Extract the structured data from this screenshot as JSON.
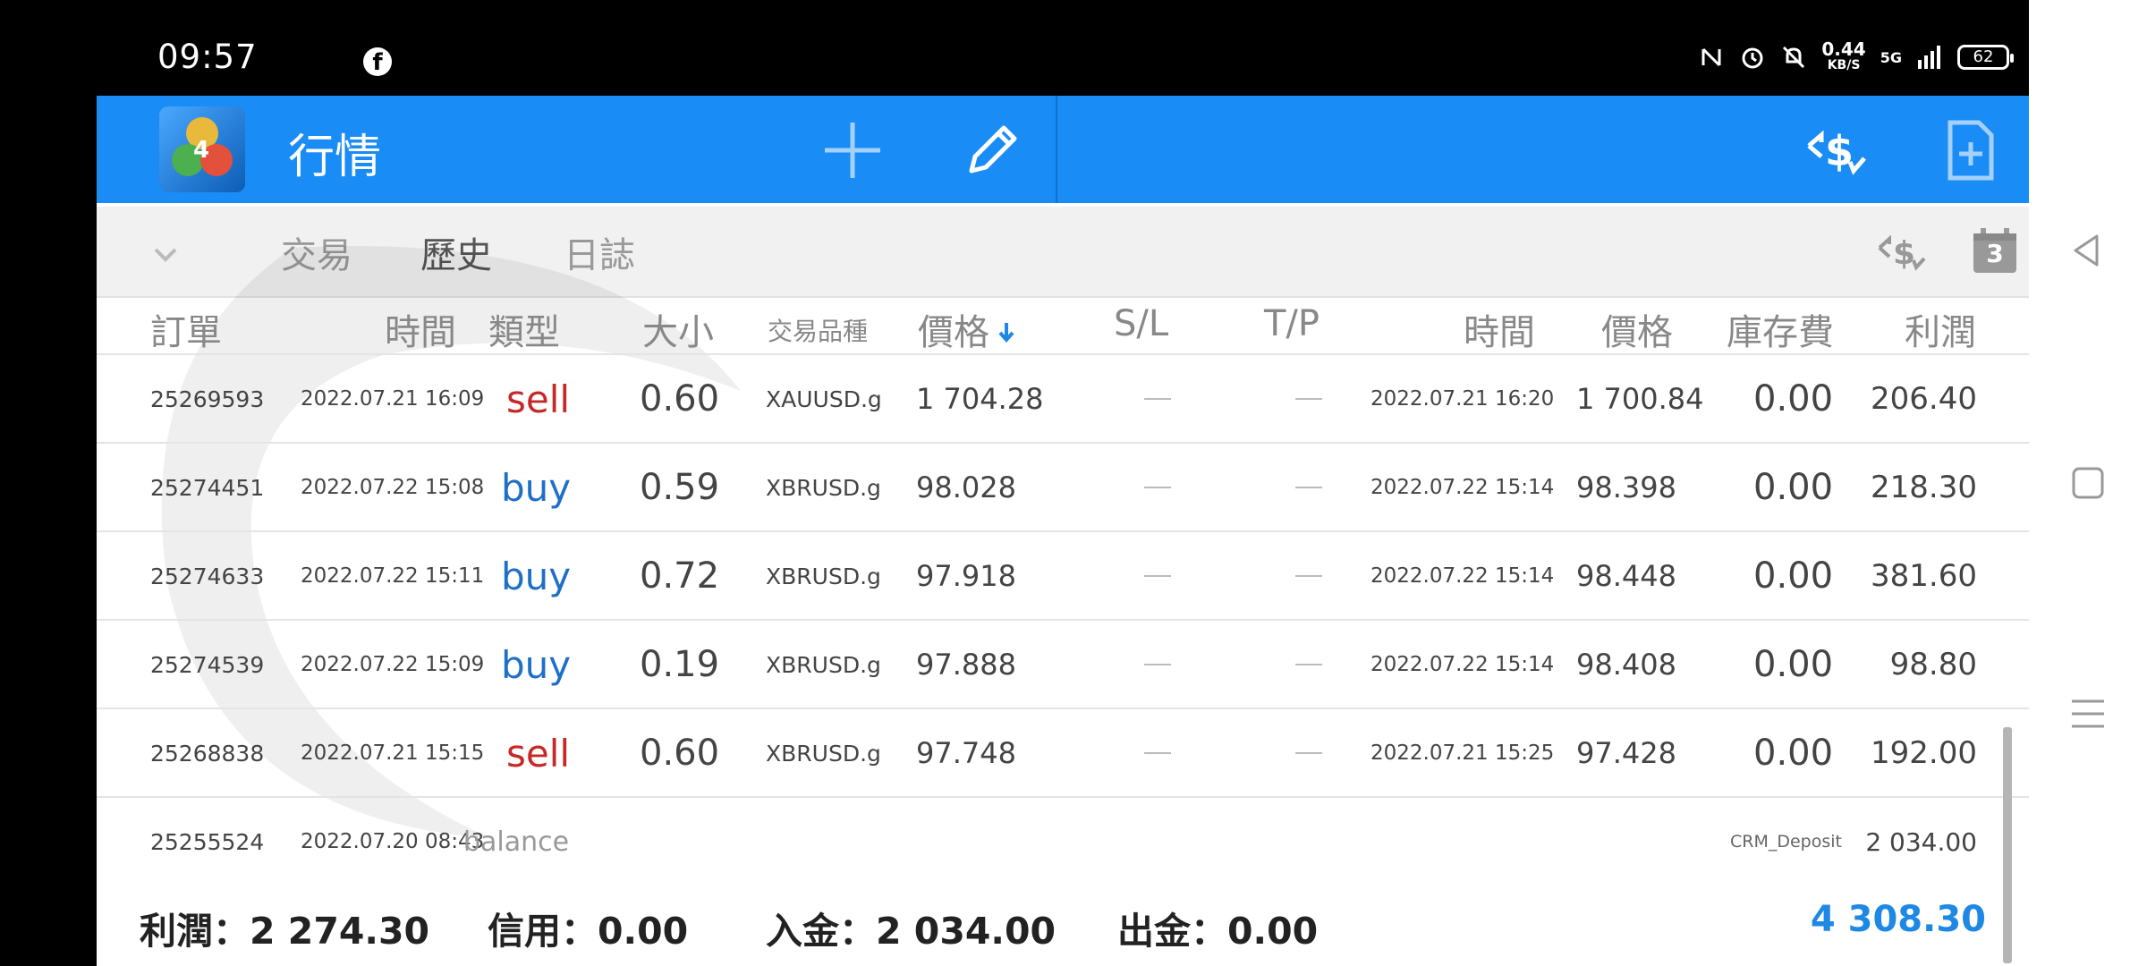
{
  "status_bar": {
    "time": "09:57",
    "speed_value": "0.44",
    "speed_unit": "KB/S",
    "network": "5G",
    "battery": "62",
    "icons": [
      "facebook-icon",
      "nfc-icon",
      "alarm-icon",
      "mute-icon",
      "signal-icon",
      "battery-icon"
    ]
  },
  "app_bar": {
    "title": "行情",
    "icons": [
      "add-icon",
      "edit-icon",
      "currency-exchange-icon",
      "new-document-icon"
    ],
    "color": "#1a8cf5"
  },
  "tabs": {
    "items": [
      "交易",
      "歷史",
      "日誌"
    ],
    "active": "歷史",
    "calendar_day": "3"
  },
  "table": {
    "headers": {
      "order": "訂單",
      "time": "時間",
      "type": "類型",
      "size": "大小",
      "symbol": "交易品種",
      "price": "價格",
      "sl": "S/L",
      "tp": "T/P",
      "close_time": "時間",
      "close_price": "價格",
      "swap": "庫存費",
      "profit": "利潤"
    },
    "rows": [
      {
        "order": "25269593",
        "time": "2022.07.21 16:09",
        "type": "sell",
        "size": "0.60",
        "symbol": "XAUUSD.g",
        "price": "1 704.28",
        "close_time": "2022.07.21 16:20",
        "close_price": "1 700.84",
        "swap": "0.00",
        "profit": "206.40"
      },
      {
        "order": "25274451",
        "time": "2022.07.22 15:08",
        "type": "buy",
        "size": "0.59",
        "symbol": "XBRUSD.g",
        "price": "98.028",
        "close_time": "2022.07.22 15:14",
        "close_price": "98.398",
        "swap": "0.00",
        "profit": "218.30"
      },
      {
        "order": "25274633",
        "time": "2022.07.22 15:11",
        "type": "buy",
        "size": "0.72",
        "symbol": "XBRUSD.g",
        "price": "97.918",
        "close_time": "2022.07.22 15:14",
        "close_price": "98.448",
        "swap": "0.00",
        "profit": "381.60"
      },
      {
        "order": "25274539",
        "time": "2022.07.22 15:09",
        "type": "buy",
        "size": "0.19",
        "symbol": "XBRUSD.g",
        "price": "97.888",
        "close_time": "2022.07.22 15:14",
        "close_price": "98.408",
        "swap": "0.00",
        "profit": "98.80"
      },
      {
        "order": "25268838",
        "time": "2022.07.21 15:15",
        "type": "sell",
        "size": "0.60",
        "symbol": "XBRUSD.g",
        "price": "97.748",
        "close_time": "2022.07.21 15:25",
        "close_price": "97.428",
        "swap": "0.00",
        "profit": "192.00"
      }
    ],
    "balance_row": {
      "order": "25255524",
      "time": "2022.07.20 08:43",
      "type": "balance",
      "comment": "CRM_Deposit",
      "amount": "2 034.00"
    }
  },
  "footer": {
    "profit": "利潤：2 274.30",
    "credit": "信用：0.00",
    "deposit": "入金：2 034.00",
    "withdrawal": "出金：0.00",
    "total": "4 308.30"
  },
  "colors": {
    "sell": "#c62828",
    "buy": "#1e6fc7",
    "total": "#1e88e5"
  }
}
